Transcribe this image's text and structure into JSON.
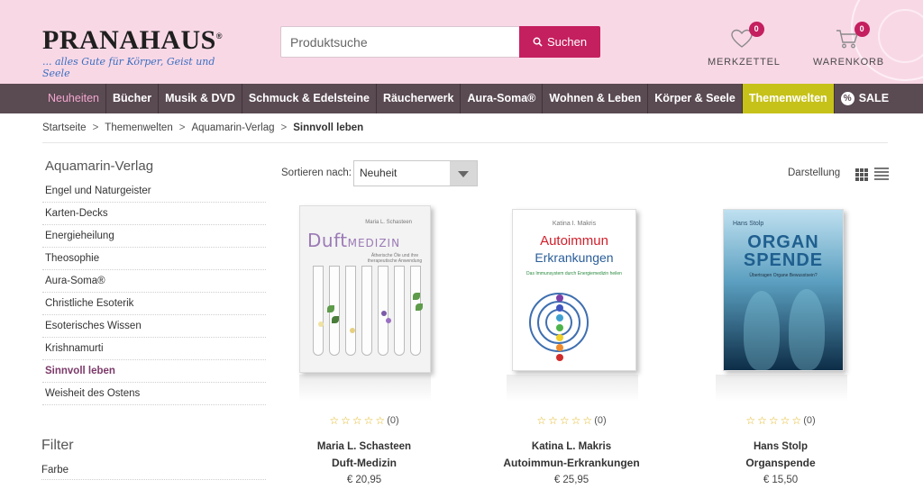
{
  "header": {
    "logo_text": "PRANAHAUS",
    "logo_reg": "®",
    "tagline": "... alles Gute für Körper, Geist und Seele",
    "search_placeholder": "Produktsuche",
    "search_button": "Suchen",
    "wishlist": {
      "label": "MERKZETTEL",
      "count": "0"
    },
    "cart": {
      "label": "WARENKORB",
      "count": "0"
    }
  },
  "nav": {
    "items": [
      "Neuheiten",
      "Bücher",
      "Musik & DVD",
      "Schmuck & Edelsteine",
      "Räucherwerk",
      "Aura-Soma®",
      "Wohnen & Leben",
      "Körper & Seele",
      "Themenwelten",
      "SALE"
    ],
    "sale_symbol": "%"
  },
  "breadcrumb": [
    "Startseite",
    "Themenwelten",
    "Aquamarin-Verlag",
    "Sinnvoll leben"
  ],
  "breadcrumb_sep": ">",
  "sidebar": {
    "title": "Aquamarin-Verlag",
    "items": [
      "Engel und Naturgeister",
      "Karten-Decks",
      "Energieheilung",
      "Theosophie",
      "Aura-Soma®",
      "Christliche Esoterik",
      "Esoterisches Wissen",
      "Krishnamurti",
      "Sinnvoll leben",
      "Weisheit des Ostens"
    ],
    "active_index": 8,
    "filter_title": "Filter",
    "filter_item": "Farbe"
  },
  "toolbar": {
    "sort_label": "Sortieren nach:",
    "sort_value": "Neuheit",
    "display_label": "Darstellung"
  },
  "products": [
    {
      "author": "Maria L. Schasteen",
      "title": "Duft-Medizin",
      "price": "€ 20,95",
      "rating_count": "(0)",
      "rating": 0,
      "cover": {
        "author": "Maria L. Schasteen",
        "title_a": "Duft",
        "title_b": "MEDIZIN",
        "subtitle": "Ätherische Öle und ihre therapeutische Anwendung"
      }
    },
    {
      "author": "Katina L. Makris",
      "title": "Autoimmun-Erkrankungen",
      "price": "€ 25,95",
      "rating_count": "(0)",
      "rating": 0,
      "cover": {
        "author": "Katina I. Makris",
        "title_a": "Autoimmun",
        "title_b": "Erkrankungen",
        "subtitle": "Das Immunsystem durch Energiemedizin heilen"
      }
    },
    {
      "author": "Hans Stolp",
      "title": "Organspende",
      "price": "€ 15,50",
      "rating_count": "(0)",
      "rating": 0,
      "cover": {
        "author": "Hans Stolp",
        "title_a": "ORGAN",
        "title_b": "SPENDE",
        "subtitle": "Übertragen Organe Bewusstsein?"
      }
    }
  ],
  "colors": {
    "accent": "#c41f5f",
    "nav_bg": "#5a4a52",
    "header_bg": "#f9d8e6",
    "theme_highlight": "#c6c21a"
  },
  "icons": {
    "wishlist": "heart-icon",
    "cart": "cart-icon",
    "search": "magnifier-icon",
    "grid_view": "grid-icon",
    "list_view": "list-icon"
  }
}
